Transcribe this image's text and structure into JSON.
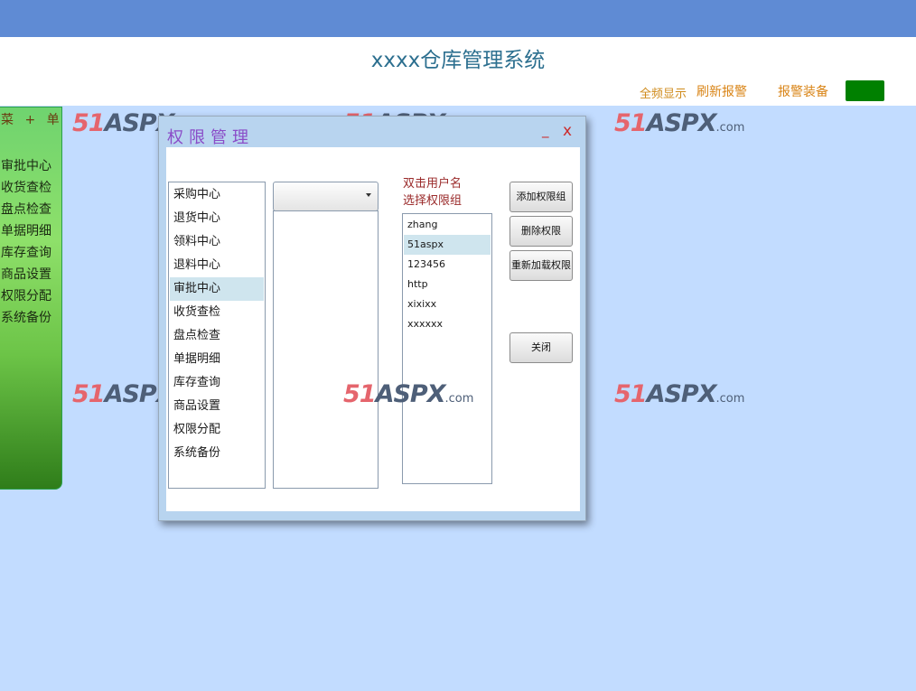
{
  "header": {
    "title": "xxxx仓库管理系统",
    "link_show_all": "全频显示",
    "link_refresh": "刷新报警",
    "link_equipment": "报警装备",
    "status_color": "#008000"
  },
  "side_menu": {
    "heading": "菜 + 单",
    "items": [
      "审批中心",
      "收货查检",
      "盘点检查",
      "单据明细",
      "库存查询",
      "商品设置",
      "权限分配",
      "系统备份"
    ]
  },
  "watermark": {
    "num": "51",
    "brand": "ASPX",
    "tld": ".com"
  },
  "dialog": {
    "title": "权限管理",
    "minimize": "_",
    "close": "x",
    "function_list": [
      "采购中心",
      "退货中心",
      "领料中心",
      "退料中心",
      "审批中心",
      "收货查检",
      "盘点检查",
      "单据明细",
      "库存查询",
      "商品设置",
      "权限分配",
      "系统备份"
    ],
    "function_selected": "审批中心",
    "group_dropdown_value": "",
    "hint_line1": "双击用户名",
    "hint_line2": "选择权限组",
    "users": [
      "zhang",
      "51aspx",
      "123456",
      "http",
      "xixixx",
      "xxxxxx"
    ],
    "user_selected": "51aspx",
    "btn_add_group": "添加权限组",
    "btn_delete": "删除权限",
    "btn_reload": "重新加载权限",
    "btn_close": "关闭"
  }
}
